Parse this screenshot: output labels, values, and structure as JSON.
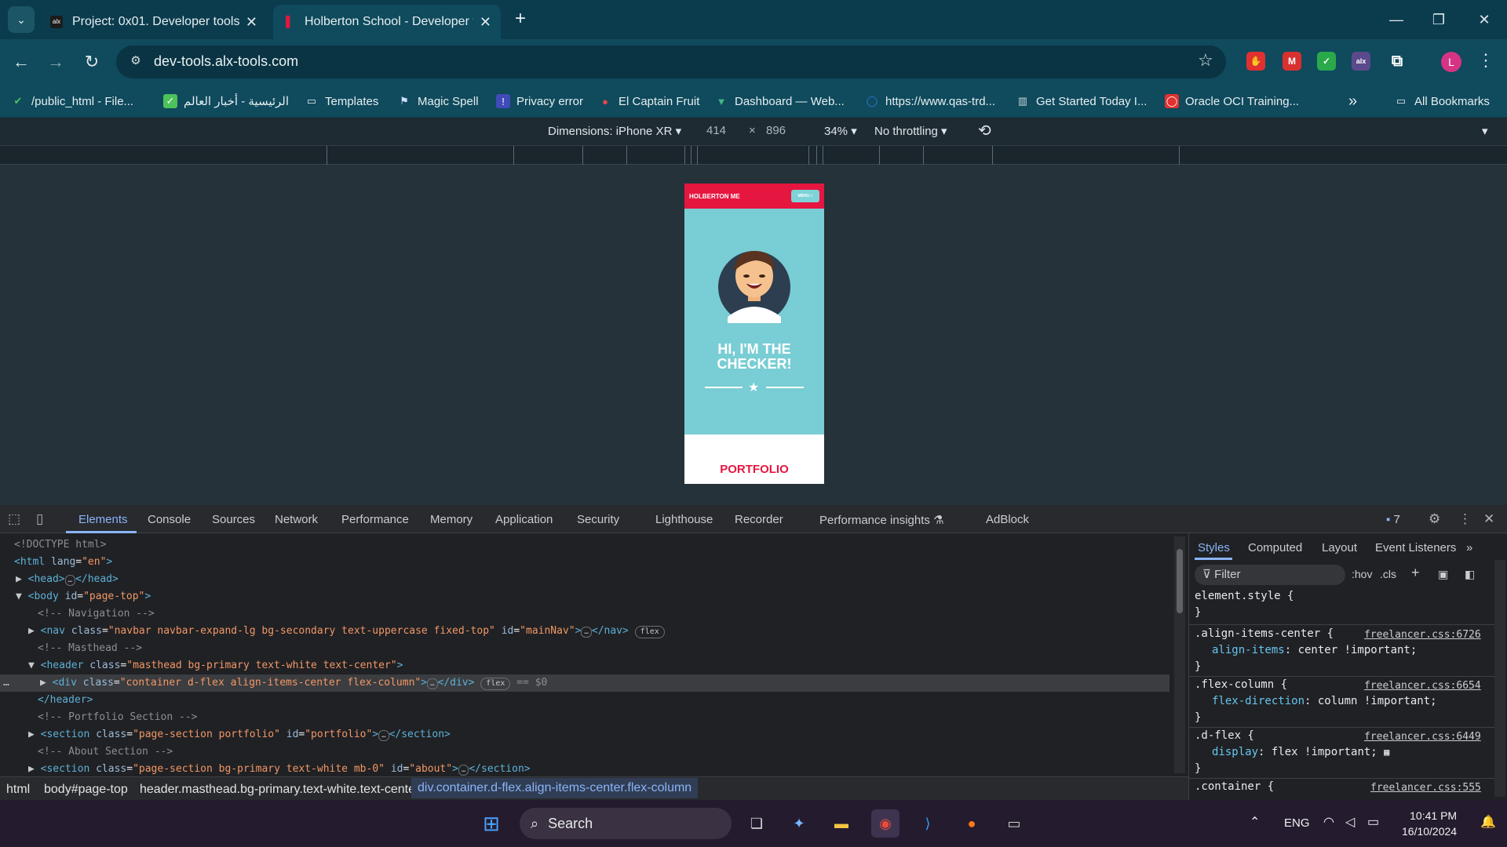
{
  "browser": {
    "tabs": [
      {
        "title": "Project: 0x01. Developer tools |",
        "active": false,
        "favicon": "alx-icon"
      },
      {
        "title": "Holberton School - Developer t",
        "active": true,
        "favicon": "holberton-icon"
      }
    ],
    "url": "dev-tools.alx-tools.com",
    "bookmarks": [
      "/public_html - File...",
      "الرئيسية - أخبار العالم",
      "Templates",
      "Magic Spell",
      "Privacy error",
      "El Captain Fruit",
      "Dashboard — Web...",
      "https://www.qas-trd...",
      "Get Started Today I...",
      "Oracle OCI Training..."
    ],
    "all_bookmarks": "All Bookmarks",
    "profile_initial": "L",
    "more_bookmarks": "»"
  },
  "device_toolbar": {
    "dimensions": "Dimensions: iPhone XR",
    "width": "414",
    "height": "896",
    "zoom": "34%",
    "throttling": "No throttling"
  },
  "page": {
    "brand": "HOLBERTON ME",
    "menu": "MENU ≡",
    "headline_line1": "HI, I'M THE",
    "headline_line2": "CHECKER!",
    "portfolio": "PORTFOLIO"
  },
  "devtools": {
    "tabs": [
      "Elements",
      "Console",
      "Sources",
      "Network",
      "Performance",
      "Memory",
      "Application",
      "Security",
      "Lighthouse",
      "Recorder",
      "Performance insights",
      "AdBlock"
    ],
    "issues_count": "7",
    "dom": {
      "doctype": "<!DOCTYPE html>",
      "html_open": "<html",
      "lang_attr": "lang",
      "lang_val": "\"en\"",
      "head": "<head>",
      "head_close": "</head>",
      "body_tag": "<body",
      "id_attr": "id",
      "body_id": "\"page-top\"",
      "comment_nav": "<!-- Navigation -->",
      "nav_tag": "<nav",
      "class_attr": "class",
      "nav_class": "\"navbar navbar-expand-lg bg-secondary text-uppercase fixed-top\"",
      "nav_id": "\"mainNav\"",
      "nav_close": "</nav>",
      "flex_pill": "flex",
      "comment_masthead": "<!-- Masthead -->",
      "header_tag": "<header",
      "header_class": "\"masthead bg-primary text-white text-center\"",
      "div_tag": "<div",
      "div_class": "\"container d-flex align-items-center flex-column\"",
      "div_close": "</div>",
      "dollar0": "== $0",
      "header_close": "</header>",
      "comment_portfolio": "<!-- Portfolio Section -->",
      "section_tag": "<section",
      "portfolio_class": "\"page-section portfolio\"",
      "portfolio_id": "\"portfolio\"",
      "section_close": "</section>",
      "comment_about": "<!-- About Section -->",
      "about_class": "\"page-section bg-primary text-white mb-0\"",
      "about_id": "\"about\"",
      "ellipsis": "…",
      "row_dots": "…"
    },
    "styles_tabs": [
      "Styles",
      "Computed",
      "Layout",
      "Event Listeners"
    ],
    "filter_placeholder": "Filter",
    "hov": ":hov",
    "cls": ".cls",
    "rules": [
      {
        "selector": "element.style {",
        "prop": "",
        "value": "",
        "source": ""
      },
      {
        "selector": ".align-items-center {",
        "prop": "align-items",
        "value": ": center !important;",
        "source": "freelancer.css:6726"
      },
      {
        "selector": ".flex-column {",
        "prop": "flex-direction",
        "value": ": column !important;",
        "source": "freelancer.css:6654"
      },
      {
        "selector": ".d-flex {",
        "prop": "display",
        "value": ": flex !important;",
        "source": "freelancer.css:6449"
      },
      {
        "selector": ".container {",
        "prop": "",
        "value": "",
        "source": "freelancer.css:555"
      }
    ],
    "close_brace": "}",
    "breadcrumbs": [
      "html",
      "body#page-top",
      "header.masthead.bg-primary.text-white.text-center",
      "div.container.d-flex.align-items-center.flex-column"
    ]
  },
  "taskbar": {
    "search": "Search",
    "lang": "ENG",
    "time": "10:41 PM",
    "date": "16/10/2024"
  },
  "colors": {
    "tab_strip": "#0b3c4e",
    "phone_nav": "#e5163f",
    "masthead": "#79cdd4",
    "devtools_accent": "#8ab4f8"
  }
}
